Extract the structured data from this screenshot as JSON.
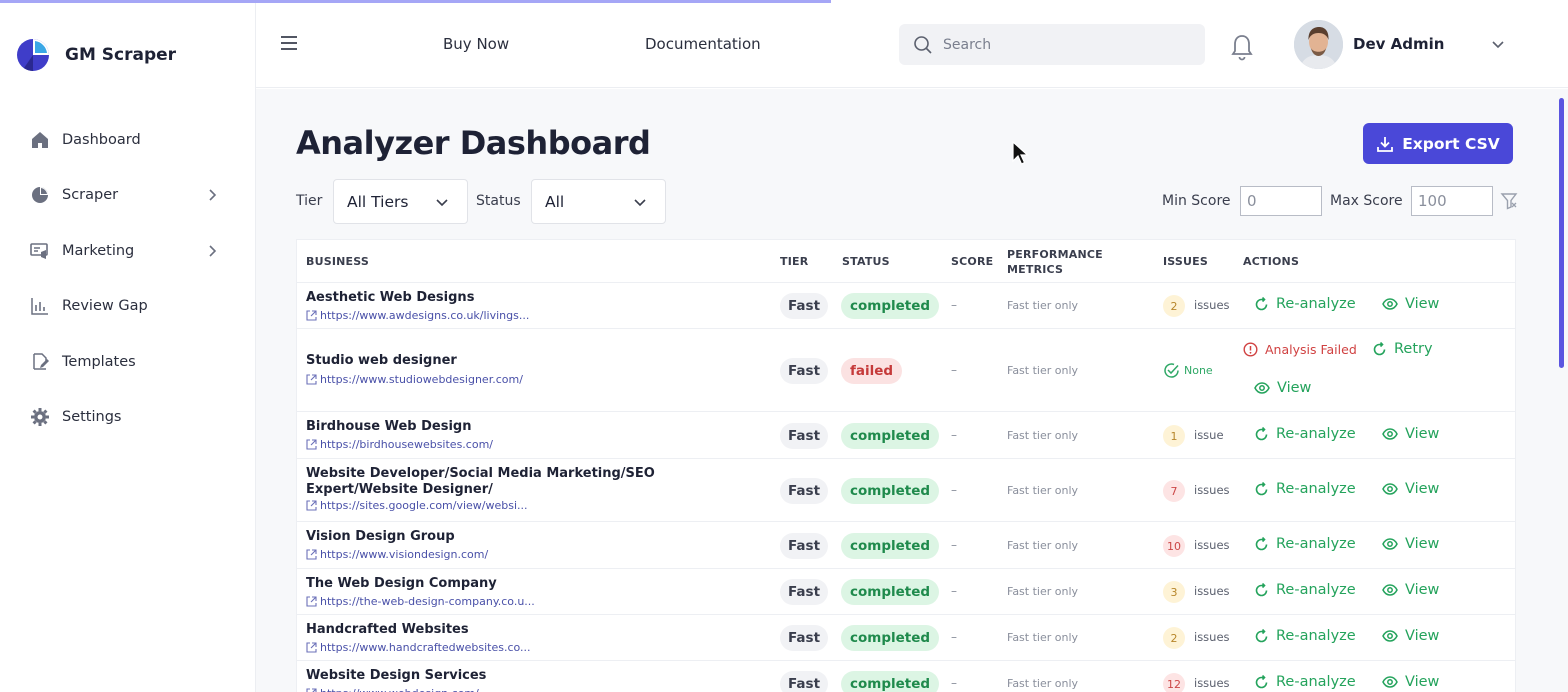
{
  "app": {
    "name": "GM Scraper"
  },
  "sidebar": {
    "items": [
      {
        "label": "Dashboard",
        "icon": "home-icon",
        "has_submenu": false
      },
      {
        "label": "Scraper",
        "icon": "pie-chart-icon",
        "has_submenu": true
      },
      {
        "label": "Marketing",
        "icon": "megaphone-icon",
        "has_submenu": true
      },
      {
        "label": "Review Gap",
        "icon": "bar-chart-icon",
        "has_submenu": false
      },
      {
        "label": "Templates",
        "icon": "file-edit-icon",
        "has_submenu": false
      },
      {
        "label": "Settings",
        "icon": "gear-icon",
        "has_submenu": false
      }
    ]
  },
  "header": {
    "links": [
      "Buy Now",
      "Documentation"
    ],
    "search": {
      "placeholder": "Search"
    },
    "user": {
      "name": "Dev Admin"
    }
  },
  "main": {
    "title": "Analyzer Dashboard",
    "export_label": "Export CSV",
    "filters": {
      "tier_label": "Tier",
      "tier_value": "All Tiers",
      "status_label": "Status",
      "status_value": "All",
      "min_score_label": "Min Score",
      "min_score_value": "0",
      "max_score_label": "Max Score",
      "max_score_value": "100"
    },
    "table": {
      "columns": [
        "BUSINESS",
        "TIER",
        "STATUS",
        "SCORE",
        "PERFORMANCE METRICS",
        "ISSUES",
        "ACTIONS"
      ],
      "rows": [
        {
          "name": "Aesthetic Web Designs",
          "url": "https://www.awdesigns.co.uk/livings...",
          "tier": "Fast",
          "status": "completed",
          "score": "–",
          "perf": "Fast tier only",
          "issues_count": "2",
          "issues_label": "issues",
          "issue_color": "yellow"
        },
        {
          "name": "Studio web designer",
          "url": "https://www.studiowebdesigner.com/",
          "tier": "Fast",
          "status": "failed",
          "score": "–",
          "perf": "Fast tier only",
          "issues_count": "",
          "issues_label": "None",
          "issue_color": "none",
          "failed_label": "Analysis Failed",
          "retry_label": "Retry"
        },
        {
          "name": "Birdhouse Web Design",
          "url": "https://birdhousewebsites.com/",
          "tier": "Fast",
          "status": "completed",
          "score": "–",
          "perf": "Fast tier only",
          "issues_count": "1",
          "issues_label": "issue",
          "issue_color": "yellow"
        },
        {
          "name": "Website Developer/Social Media Marketing/SEO Expert/Website Designer/",
          "url": "https://sites.google.com/view/websi...",
          "tier": "Fast",
          "status": "completed",
          "score": "–",
          "perf": "Fast tier only",
          "issues_count": "7",
          "issues_label": "issues",
          "issue_color": "red"
        },
        {
          "name": "Vision Design Group",
          "url": "https://www.visiondesign.com/",
          "tier": "Fast",
          "status": "completed",
          "score": "–",
          "perf": "Fast tier only",
          "issues_count": "10",
          "issues_label": "issues",
          "issue_color": "red"
        },
        {
          "name": "The Web Design Company",
          "url": "https://the-web-design-company.co.u...",
          "tier": "Fast",
          "status": "completed",
          "score": "–",
          "perf": "Fast tier only",
          "issues_count": "3",
          "issues_label": "issues",
          "issue_color": "yellow"
        },
        {
          "name": "Handcrafted Websites",
          "url": "https://www.handcraftedwebsites.co...",
          "tier": "Fast",
          "status": "completed",
          "score": "–",
          "perf": "Fast tier only",
          "issues_count": "2",
          "issues_label": "issues",
          "issue_color": "yellow"
        },
        {
          "name": "Website Design Services",
          "url": "https://www.webdesign.com/",
          "tier": "Fast",
          "status": "completed",
          "score": "–",
          "perf": "Fast tier only",
          "issues_count": "12",
          "issues_label": "issues",
          "issue_color": "red"
        }
      ],
      "action_reanalyze": "Re-analyze",
      "action_view": "View"
    }
  },
  "colors": {
    "accent": "#4a48d8",
    "success": "#24a35c",
    "danger": "#d04141"
  }
}
